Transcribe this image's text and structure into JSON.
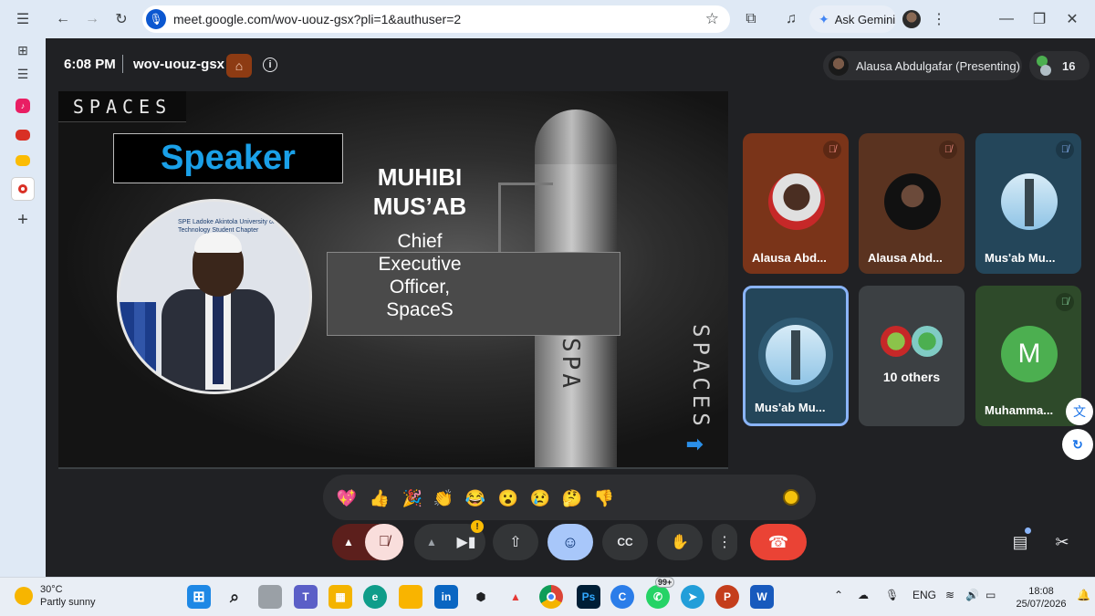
{
  "browser": {
    "url": "meet.google.com/wov-uouz-gsx?pli=1&authuser=2",
    "gemini_label": "Ask Gemini"
  },
  "meet": {
    "time": "6:08 PM",
    "code": "wov-uouz-gsx",
    "presenting_label": "Alausa Abdulgafar (Presenting)",
    "participant_count": "16"
  },
  "slide": {
    "logo_text": "SPACES",
    "heading": "Speaker",
    "speaker_name_line1": "MUHIBI",
    "speaker_name_line2": "MUS’AB",
    "role_line1": "Chief",
    "role_line2": "Executive",
    "role_line3": "Officer,",
    "role_line4": "SpaceS",
    "photo_banner": "SPE Ladoke Akintola University of Technology Student Chapter",
    "rocket_text": "SPA",
    "side_logo": "SPACES"
  },
  "tiles": [
    {
      "name": "Alausa Abd...",
      "muted": true
    },
    {
      "name": "Alausa Abd...",
      "muted": true
    },
    {
      "name": "Mus'ab Mu...",
      "muted": true
    },
    {
      "name": "Mus'ab Mu...",
      "muted": false,
      "speaking": true
    },
    {
      "name": "10 others",
      "muted": false
    },
    {
      "name": "Muhamma...",
      "muted": true,
      "initial": "M"
    }
  ],
  "reactions": [
    "💖",
    "👍",
    "🎉",
    "👏",
    "😂",
    "😮",
    "😢",
    "🤔",
    "👎"
  ],
  "controls": {
    "mic_state": "muted",
    "camera_warning": "!"
  },
  "taskbar": {
    "temperature": "30°C",
    "weather": "Partly sunny",
    "badge_count": "99+",
    "language": "ENG",
    "clock_time": "18:08",
    "clock_date": "25/07/2026"
  },
  "colors": {
    "end_call": "#ea4335",
    "mic_muted_bg": "#f9dedc",
    "active_tile_border": "#8ab4f8",
    "speaker_heading": "#1aa0e8"
  }
}
